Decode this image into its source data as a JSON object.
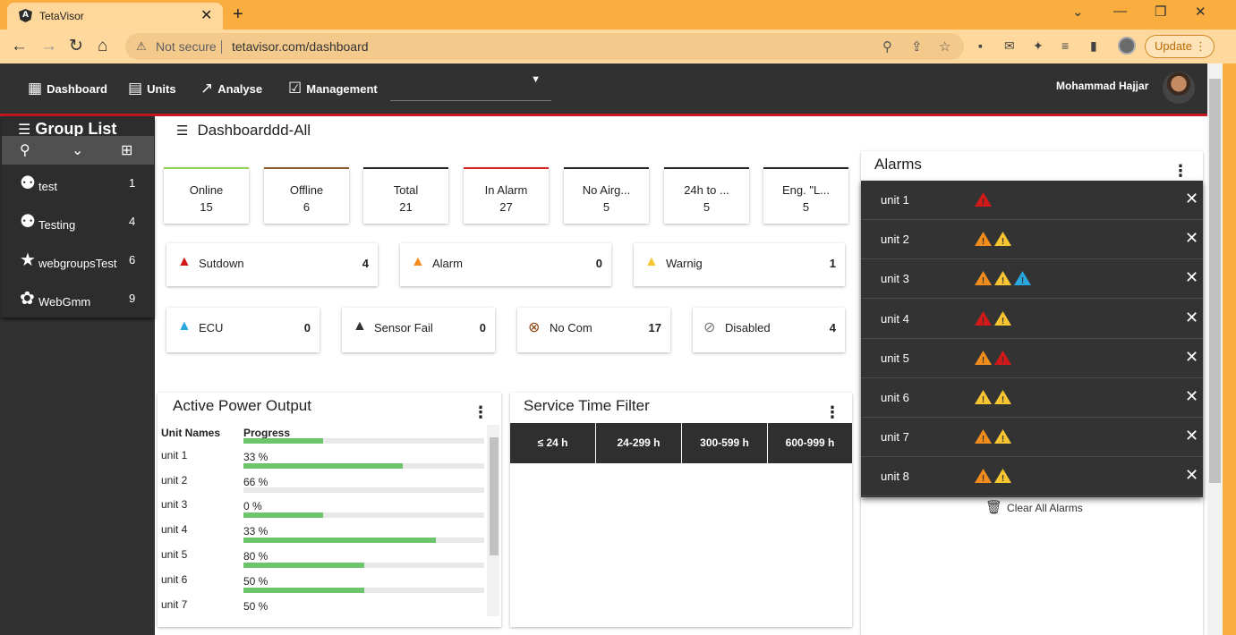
{
  "browser": {
    "tab_title": "TetaVisor",
    "tab_favicon_letter": "A",
    "not_secure": "Not secure",
    "url": "tetavisor.com/dashboard",
    "update_label": "Update"
  },
  "nav": {
    "items": [
      {
        "label": "Dashboard",
        "icon": "dashboard-icon"
      },
      {
        "label": "Units",
        "icon": "units-icon"
      },
      {
        "label": "Analyse",
        "icon": "trending-icon"
      },
      {
        "label": "Management",
        "icon": "management-icon"
      }
    ],
    "user_name": "Mohammad Hajjar"
  },
  "sidebar": {
    "title": "Group List",
    "groups": [
      {
        "label": "test",
        "count": "1",
        "icon": "group-icon"
      },
      {
        "label": "Testing",
        "count": "4",
        "icon": "group-icon"
      },
      {
        "label": "webgroupsTest",
        "count": "6",
        "icon": "star-icon"
      },
      {
        "label": "WebGmm",
        "count": "9",
        "icon": "palette-icon"
      }
    ]
  },
  "page": {
    "title": "Dashboarddd-All"
  },
  "stats": [
    {
      "label": "Online",
      "value": "15",
      "color": "#8fd14f"
    },
    {
      "label": "Offline",
      "value": "6",
      "color": "#8b5a2b"
    },
    {
      "label": "Total",
      "value": "21",
      "color": "#222222"
    },
    {
      "label": "In Alarm",
      "value": "27",
      "color": "#d42020"
    },
    {
      "label": "No Airg...",
      "value": "5",
      "color": "#222222"
    },
    {
      "label": "24h to ...",
      "value": "5",
      "color": "#222222"
    },
    {
      "label": "Eng. \"L...",
      "value": "5",
      "color": "#222222"
    }
  ],
  "status_row1": [
    {
      "label": "Sutdown",
      "value": "4",
      "icon": "warning-red-icon",
      "color": "#d11919"
    },
    {
      "label": "Alarm",
      "value": "0",
      "icon": "warning-orange-icon",
      "color": "#f28c1c"
    },
    {
      "label": "Warnig",
      "value": "1",
      "icon": "warning-yellow-icon",
      "color": "#f7c531"
    }
  ],
  "status_row2": [
    {
      "label": "ECU",
      "value": "0",
      "icon": "warning-blue-icon",
      "color": "#29a8e0"
    },
    {
      "label": "Sensor Fail",
      "value": "0",
      "icon": "warning-dark-icon",
      "color": "#333333"
    },
    {
      "label": "No Com",
      "value": "17",
      "icon": "no-com-icon",
      "color": "#8b4513"
    },
    {
      "label": "Disabled",
      "value": "4",
      "icon": "disabled-icon",
      "color": "#777777"
    }
  ],
  "power": {
    "title": "Active Power Output",
    "col_names": "Unit Names",
    "col_progress": "Progress",
    "rows": [
      {
        "name": "unit 1",
        "progress": 33,
        "label": "33 %"
      },
      {
        "name": "unit 2",
        "progress": 66,
        "label": "66 %"
      },
      {
        "name": "unit 3",
        "progress": 0,
        "label": "0 %"
      },
      {
        "name": "unit 4",
        "progress": 33,
        "label": "33 %"
      },
      {
        "name": "unit 5",
        "progress": 80,
        "label": "80 %"
      },
      {
        "name": "unit 6",
        "progress": 50,
        "label": "50 %"
      },
      {
        "name": "unit 7",
        "progress": 50,
        "label": "50 %"
      }
    ]
  },
  "service": {
    "title": "Service Time Filter",
    "filters": [
      "≤ 24 h",
      "24-299 h",
      "300-599 h",
      "600-999 h"
    ]
  },
  "alarms": {
    "title": "Alarms",
    "clear_label": "Clear All Alarms",
    "rows": [
      {
        "name": "unit 1",
        "levels": [
          "red"
        ]
      },
      {
        "name": "unit 2",
        "levels": [
          "orange",
          "yellow"
        ]
      },
      {
        "name": "unit 3",
        "levels": [
          "orange",
          "yellow",
          "blue"
        ]
      },
      {
        "name": "unit 4",
        "levels": [
          "red",
          "yellow"
        ]
      },
      {
        "name": "unit 5",
        "levels": [
          "orange",
          "red"
        ]
      },
      {
        "name": "unit 6",
        "levels": [
          "yellow",
          "yellow"
        ]
      },
      {
        "name": "unit 7",
        "levels": [
          "orange",
          "yellow"
        ]
      },
      {
        "name": "unit 8",
        "levels": [
          "orange",
          "yellow"
        ]
      }
    ],
    "level_colors": {
      "red": "#d11919",
      "orange": "#f28c1c",
      "yellow": "#f7c531",
      "blue": "#29a8e0"
    }
  }
}
